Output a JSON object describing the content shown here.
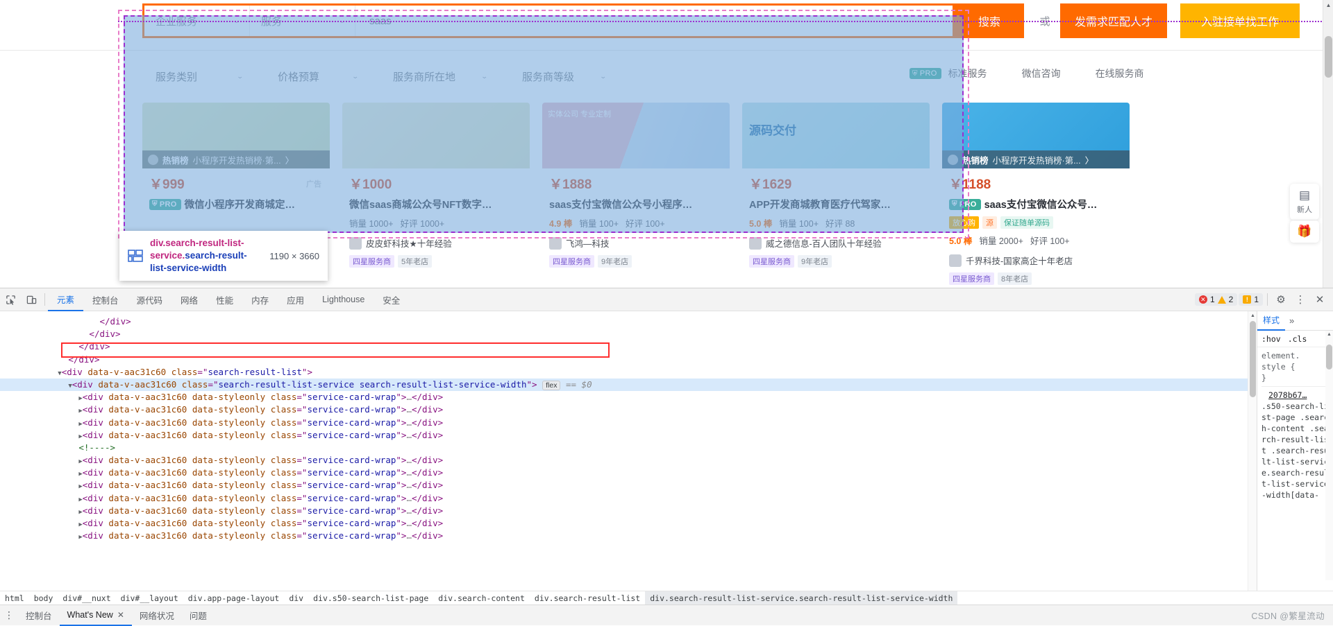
{
  "webpage": {
    "search": {
      "category": "企业服务",
      "category_caret": "⌄",
      "service": "服务",
      "service_caret": "⌄",
      "keyword": "saas",
      "search_button": "搜索",
      "or_text": "或",
      "match_button": "发需求匹配人才",
      "join_button": "入驻接单找工作"
    },
    "filters": [
      {
        "label": "服务类别",
        "caret": "⌄"
      },
      {
        "label": "价格预算",
        "caret": "⌄"
      },
      {
        "label": "服务商所在地",
        "caret": "⌄"
      },
      {
        "label": "服务商等级",
        "caret": "⌄"
      }
    ],
    "toggles": [
      {
        "label": "标准服务",
        "badge": "PRO"
      },
      {
        "label": "微信咨询",
        "badge": ""
      },
      {
        "label": "在线服务商",
        "badge": ""
      }
    ],
    "cards": [
      {
        "hot_tag": "热销榜",
        "hot_text": "小程序开发热销榜·第...",
        "hot_arrow": "〉",
        "price": "￥999",
        "ad": "广告",
        "pro": "PRO",
        "title": "微信小程序开发商城定…",
        "coupons": [],
        "sales": "",
        "reviews": "",
        "score": "",
        "shop": "",
        "tags": []
      },
      {
        "hot_tag": "",
        "hot_text": "",
        "hot_arrow": "",
        "price": "￥1000",
        "ad": "",
        "pro": "",
        "title": "微信saas商城公众号NFT数字…",
        "coupons": [],
        "sales": "销量 1000+",
        "reviews": "好评 1000+",
        "score": "",
        "shop": "皮皮虾科技★十年经验",
        "tags": [
          "四星服务商",
          "5年老店"
        ]
      },
      {
        "hot_tag": "",
        "hot_text": "实体公司 专业定制",
        "hot_arrow": "",
        "price": "￥1888",
        "ad": "",
        "pro": "",
        "title": "saas支付宝微信公众号小程序…",
        "coupons": [],
        "sales": "销量 100+",
        "reviews": "好评 100+",
        "score": "4.9 棒",
        "shop": "飞鸿—科技",
        "tags": [
          "四星服务商",
          "9年老店"
        ]
      },
      {
        "hot_tag": "",
        "hot_text": "源码交付",
        "hot_arrow": "",
        "price": "￥1629",
        "ad": "",
        "pro": "",
        "title": "APP开发商城教育医疗代驾家…",
        "coupons": [],
        "sales": "销量 100+",
        "reviews": "好评 88",
        "score": "5.0 棒",
        "shop": "威之德信息-百人团队十年经验",
        "tags": [
          "四星服务商",
          "9年老店"
        ]
      },
      {
        "hot_tag": "热销榜",
        "hot_text": "小程序开发热销榜·第...",
        "hot_arrow": "〉",
        "price": "￥1188",
        "ad": "",
        "pro": "PRO",
        "title": "saas支付宝微信公众号…",
        "coupons": [
          "放心购",
          "源",
          "保证随单源码"
        ],
        "sales": "销量 2000+",
        "reviews": "好评 100+",
        "score": "5.0 棒",
        "shop": "千界科技-国家高企十年老店",
        "tags": [
          "四星服务商",
          "8年老店"
        ]
      }
    ],
    "float_widgets": [
      {
        "icon": "▤",
        "label": "新人"
      },
      {
        "icon": "🎁",
        "label": ""
      }
    ],
    "tooltip": {
      "icon": "grid-icon",
      "selector_line1": "div.search-result-list-service.",
      "selector_line2": "search-result-list-service-wid",
      "selector_line3": "th",
      "size": "1190 × 3660"
    }
  },
  "devtools": {
    "toolbar": {
      "inspect_icon": "cursor-box-icon",
      "device_icon": "device-toggle-icon",
      "tabs": [
        {
          "label": "元素",
          "active": true
        },
        {
          "label": "控制台",
          "active": false
        },
        {
          "label": "源代码",
          "active": false
        },
        {
          "label": "网络",
          "active": false
        },
        {
          "label": "性能",
          "active": false
        },
        {
          "label": "内存",
          "active": false
        },
        {
          "label": "应用",
          "active": false
        },
        {
          "label": "Lighthouse",
          "active": false
        },
        {
          "label": "安全",
          "active": false
        }
      ],
      "errors": "1",
      "warnings": "2",
      "messages": "1",
      "gear": "⚙",
      "kebab": "⋮",
      "close": "✕"
    },
    "dom": [
      {
        "indent": 9,
        "type": "close",
        "text": "</div>"
      },
      {
        "indent": 8,
        "type": "close",
        "text": "</div>"
      },
      {
        "indent": 7,
        "type": "close",
        "text": "</div>"
      },
      {
        "indent": 6,
        "type": "close",
        "text": "</div>"
      },
      {
        "indent": 5,
        "type": "open",
        "tri": "▼",
        "tag": "div",
        "attr1": "data-v-aac31c60",
        "attr2": "class",
        "val2": "search-result-list",
        "tail": ">"
      },
      {
        "indent": 6,
        "type": "selected",
        "tri": "▼",
        "tag": "div",
        "attr1": "data-v-aac31c60",
        "attr2": "class",
        "val2": "search-result-list-service search-result-list-service-width",
        "tail": ">",
        "badge": "flex",
        "dollar": "== $0"
      },
      {
        "indent": 7,
        "type": "collapsed",
        "tri": "▶",
        "tag": "div",
        "attr1": "data-v-aac31c60",
        "attrx": "data-styleonly",
        "attr2": "class",
        "val2": "service-card-wrap",
        "tail": ">…</div>"
      },
      {
        "indent": 7,
        "type": "collapsed",
        "tri": "▶",
        "tag": "div",
        "attr1": "data-v-aac31c60",
        "attrx": "data-styleonly",
        "attr2": "class",
        "val2": "service-card-wrap",
        "tail": ">…</div>"
      },
      {
        "indent": 7,
        "type": "collapsed",
        "tri": "▶",
        "tag": "div",
        "attr1": "data-v-aac31c60",
        "attrx": "data-styleonly",
        "attr2": "class",
        "val2": "service-card-wrap",
        "tail": ">…</div>"
      },
      {
        "indent": 7,
        "type": "collapsed",
        "tri": "▶",
        "tag": "div",
        "attr1": "data-v-aac31c60",
        "attrx": "data-styleonly",
        "attr2": "class",
        "val2": "service-card-wrap",
        "tail": ">…</div>"
      },
      {
        "indent": 7,
        "type": "comment",
        "text": "<!---->"
      },
      {
        "indent": 7,
        "type": "collapsed",
        "tri": "▶",
        "tag": "div",
        "attr1": "data-v-aac31c60",
        "attrx": "data-styleonly",
        "attr2": "class",
        "val2": "service-card-wrap",
        "tail": ">…</div>"
      },
      {
        "indent": 7,
        "type": "collapsed",
        "tri": "▶",
        "tag": "div",
        "attr1": "data-v-aac31c60",
        "attrx": "data-styleonly",
        "attr2": "class",
        "val2": "service-card-wrap",
        "tail": ">…</div>"
      },
      {
        "indent": 7,
        "type": "collapsed",
        "tri": "▶",
        "tag": "div",
        "attr1": "data-v-aac31c60",
        "attrx": "data-styleonly",
        "attr2": "class",
        "val2": "service-card-wrap",
        "tail": ">…</div>"
      },
      {
        "indent": 7,
        "type": "collapsed",
        "tri": "▶",
        "tag": "div",
        "attr1": "data-v-aac31c60",
        "attrx": "data-styleonly",
        "attr2": "class",
        "val2": "service-card-wrap",
        "tail": ">…</div>"
      },
      {
        "indent": 7,
        "type": "collapsed",
        "tri": "▶",
        "tag": "div",
        "attr1": "data-v-aac31c60",
        "attrx": "data-styleonly",
        "attr2": "class",
        "val2": "service-card-wrap",
        "tail": ">…</div>"
      },
      {
        "indent": 7,
        "type": "collapsed",
        "tri": "▶",
        "tag": "div",
        "attr1": "data-v-aac31c60",
        "attrx": "data-styleonly",
        "attr2": "class",
        "val2": "service-card-wrap",
        "tail": ">…</div>"
      },
      {
        "indent": 7,
        "type": "collapsed",
        "tri": "▶",
        "tag": "div",
        "attr1": "data-v-aac31c60",
        "attrx": "data-styleonly",
        "attr2": "class",
        "val2": "service-card-wrap",
        "tail": ">…</div>"
      }
    ],
    "styles": {
      "tabs": [
        {
          "label": "样式",
          "active": true
        }
      ],
      "more": "»",
      "hov": ":hov",
      "cls": ".cls",
      "element_style": "element.\nstyle {\n}",
      "source": "2078b67…",
      "selector": ".s50-search-list-page .search-content .search-result-list .search-result-list-service.search-result-list-service-width[data-"
    },
    "breadcrumbs": [
      {
        "label": "html",
        "active": false
      },
      {
        "label": "body",
        "active": false
      },
      {
        "label": "div#__nuxt",
        "active": false
      },
      {
        "label": "div#__layout",
        "active": false
      },
      {
        "label": "div.app-page-layout",
        "active": false
      },
      {
        "label": "div",
        "active": false
      },
      {
        "label": "div.s50-search-list-page",
        "active": false
      },
      {
        "label": "div.search-content",
        "active": false
      },
      {
        "label": "div.search-result-list",
        "active": false
      },
      {
        "label": "div.search-result-list-service.search-result-list-service-width",
        "active": true
      }
    ],
    "drawer": {
      "kebab": "⋮",
      "tabs": [
        {
          "label": "控制台",
          "active": false,
          "closable": false
        },
        {
          "label": "What's New",
          "active": true,
          "closable": true,
          "close": "✕"
        },
        {
          "label": "网络状况",
          "active": false,
          "closable": false
        },
        {
          "label": "问题",
          "active": false,
          "closable": false
        }
      ],
      "watermark": "CSDN @繁星流动"
    }
  }
}
